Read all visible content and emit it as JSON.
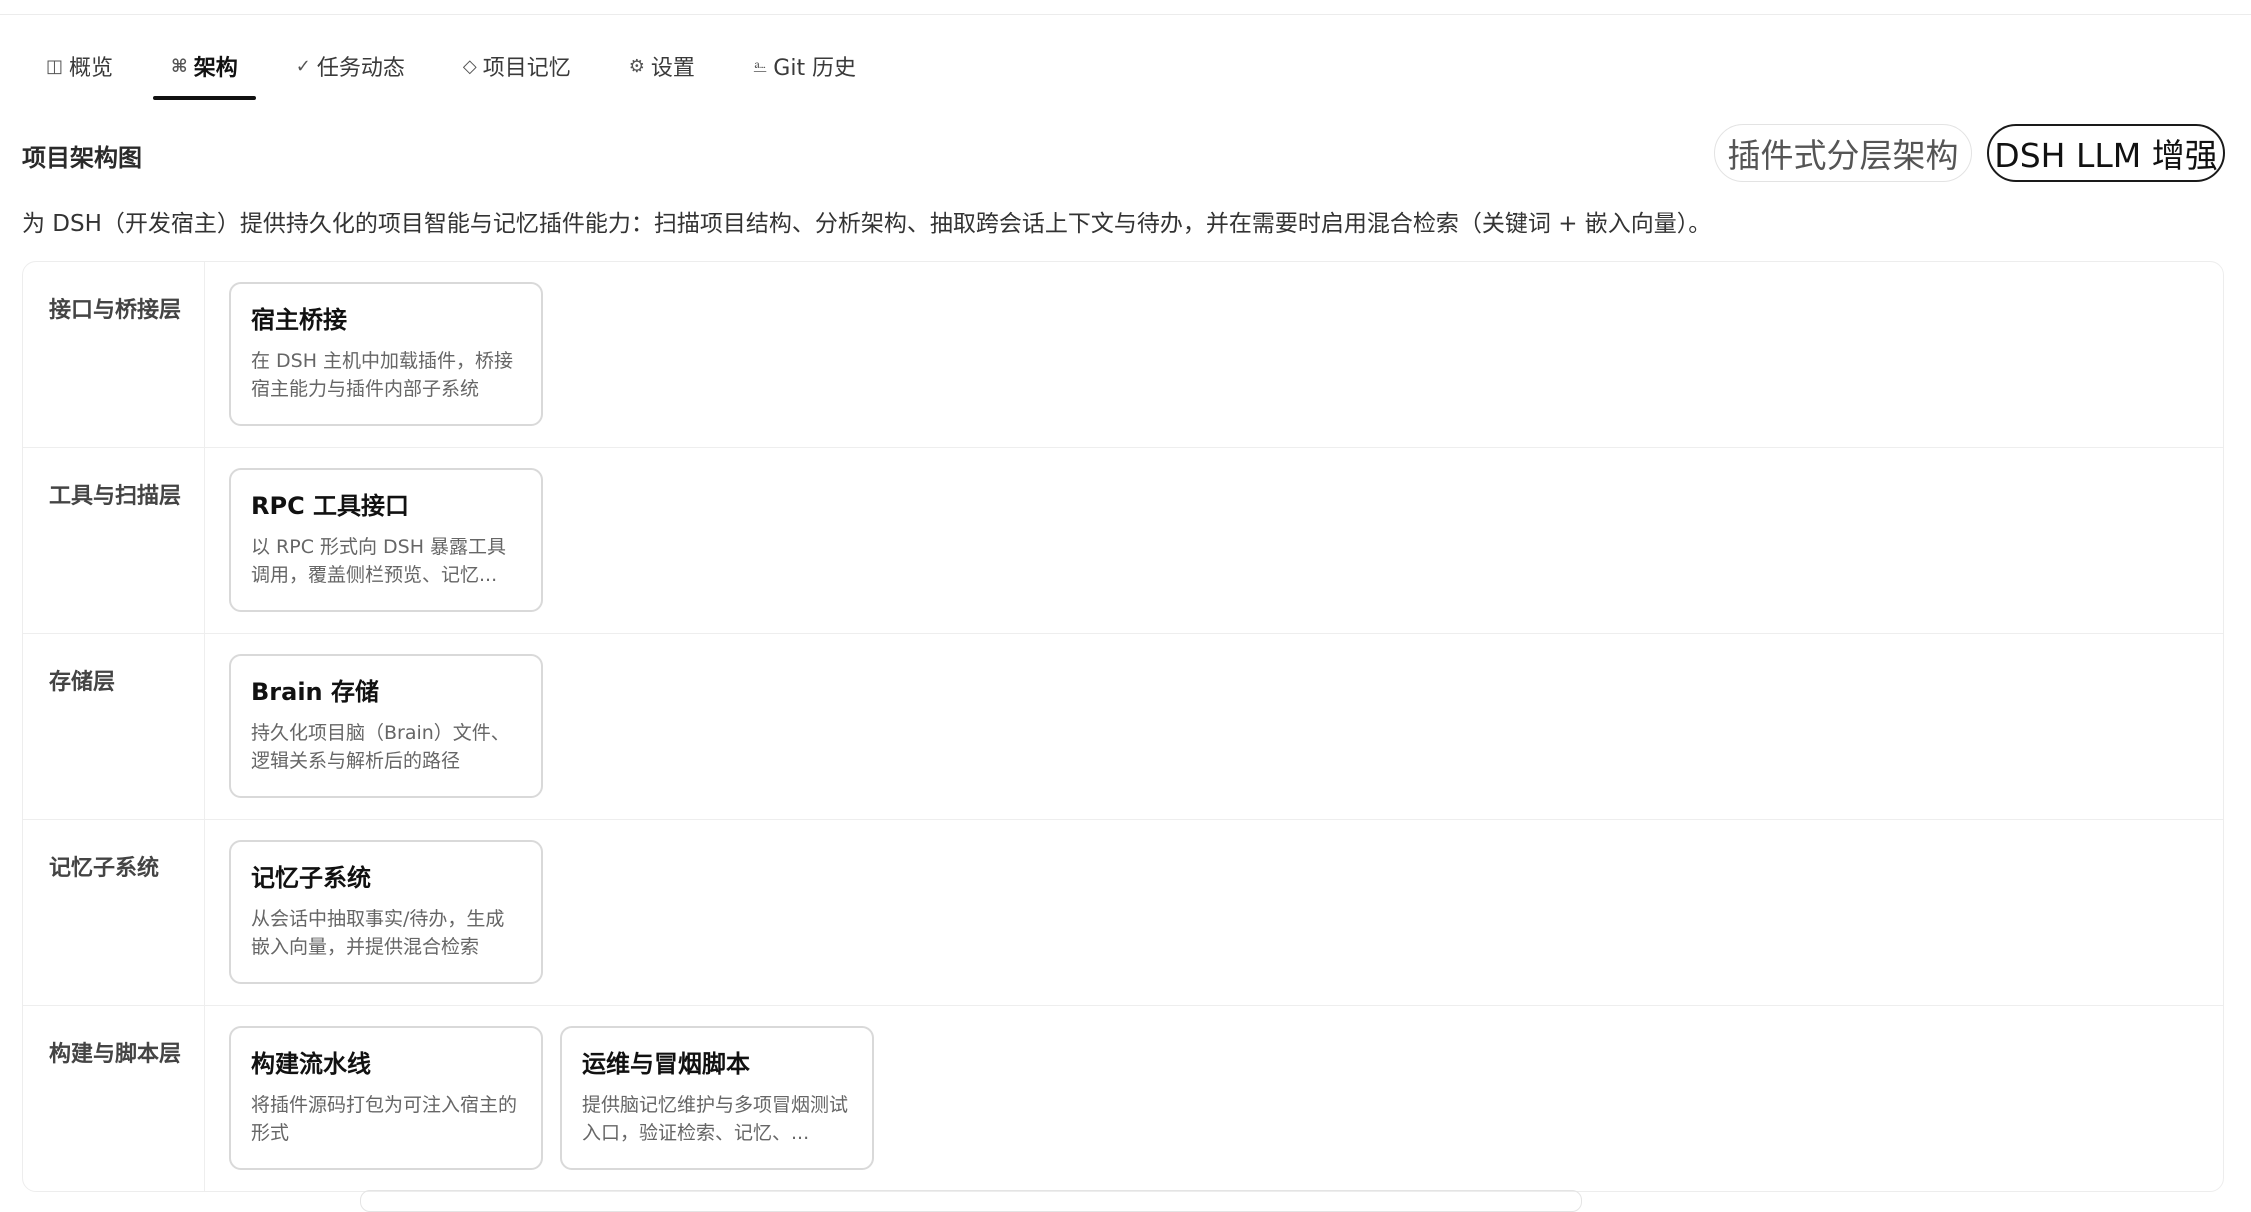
{
  "tabs": [
    {
      "icon": "◫",
      "label": "概览",
      "active": false
    },
    {
      "icon": "⌘",
      "label": "架构",
      "active": true
    },
    {
      "icon": "✓",
      "label": "任务动态",
      "active": false
    },
    {
      "icon": "◇",
      "label": "项目记忆",
      "active": false
    },
    {
      "icon": "⚙",
      "label": "设置",
      "active": false
    },
    {
      "icon": "⎁",
      "label": "Git 历史",
      "active": false
    }
  ],
  "section": {
    "title": "项目架构图",
    "pill_light": "插件式分层架构",
    "pill_dark": "DSH LLM 增强",
    "description": "为 DSH（开发宿主）提供持久化的项目智能与记忆插件能力：扫描项目结构、分析架构、抽取跨会话上下文与待办，并在需要时启用混合检索（关键词 + 嵌入向量）。"
  },
  "layers": [
    {
      "label": "接口与桥接层",
      "cards": [
        {
          "title": "宿主桥接",
          "desc": "在 DSH 主机中加载插件，桥接宿主能力与插件内部子系统"
        }
      ]
    },
    {
      "label": "工具与扫描层",
      "cards": [
        {
          "title": "RPC 工具接口",
          "desc": "以 RPC 形式向 DSH 暴露工具调用，覆盖侧栏预览、记忆..."
        }
      ]
    },
    {
      "label": "存储层",
      "cards": [
        {
          "title": "Brain 存储",
          "desc": "持久化项目脑（Brain）文件、逻辑关系与解析后的路径"
        }
      ]
    },
    {
      "label": "记忆子系统",
      "cards": [
        {
          "title": "记忆子系统",
          "desc": "从会话中抽取事实/待办，生成嵌入向量，并提供混合检索"
        }
      ]
    },
    {
      "label": "构建与脚本层",
      "cards": [
        {
          "title": "构建流水线",
          "desc": "将插件源码打包为可注入宿主的形式"
        },
        {
          "title": "运维与冒烟脚本",
          "desc": "提供脑记忆维护与多项冒烟测试入口，验证检索、记忆、..."
        }
      ]
    }
  ]
}
